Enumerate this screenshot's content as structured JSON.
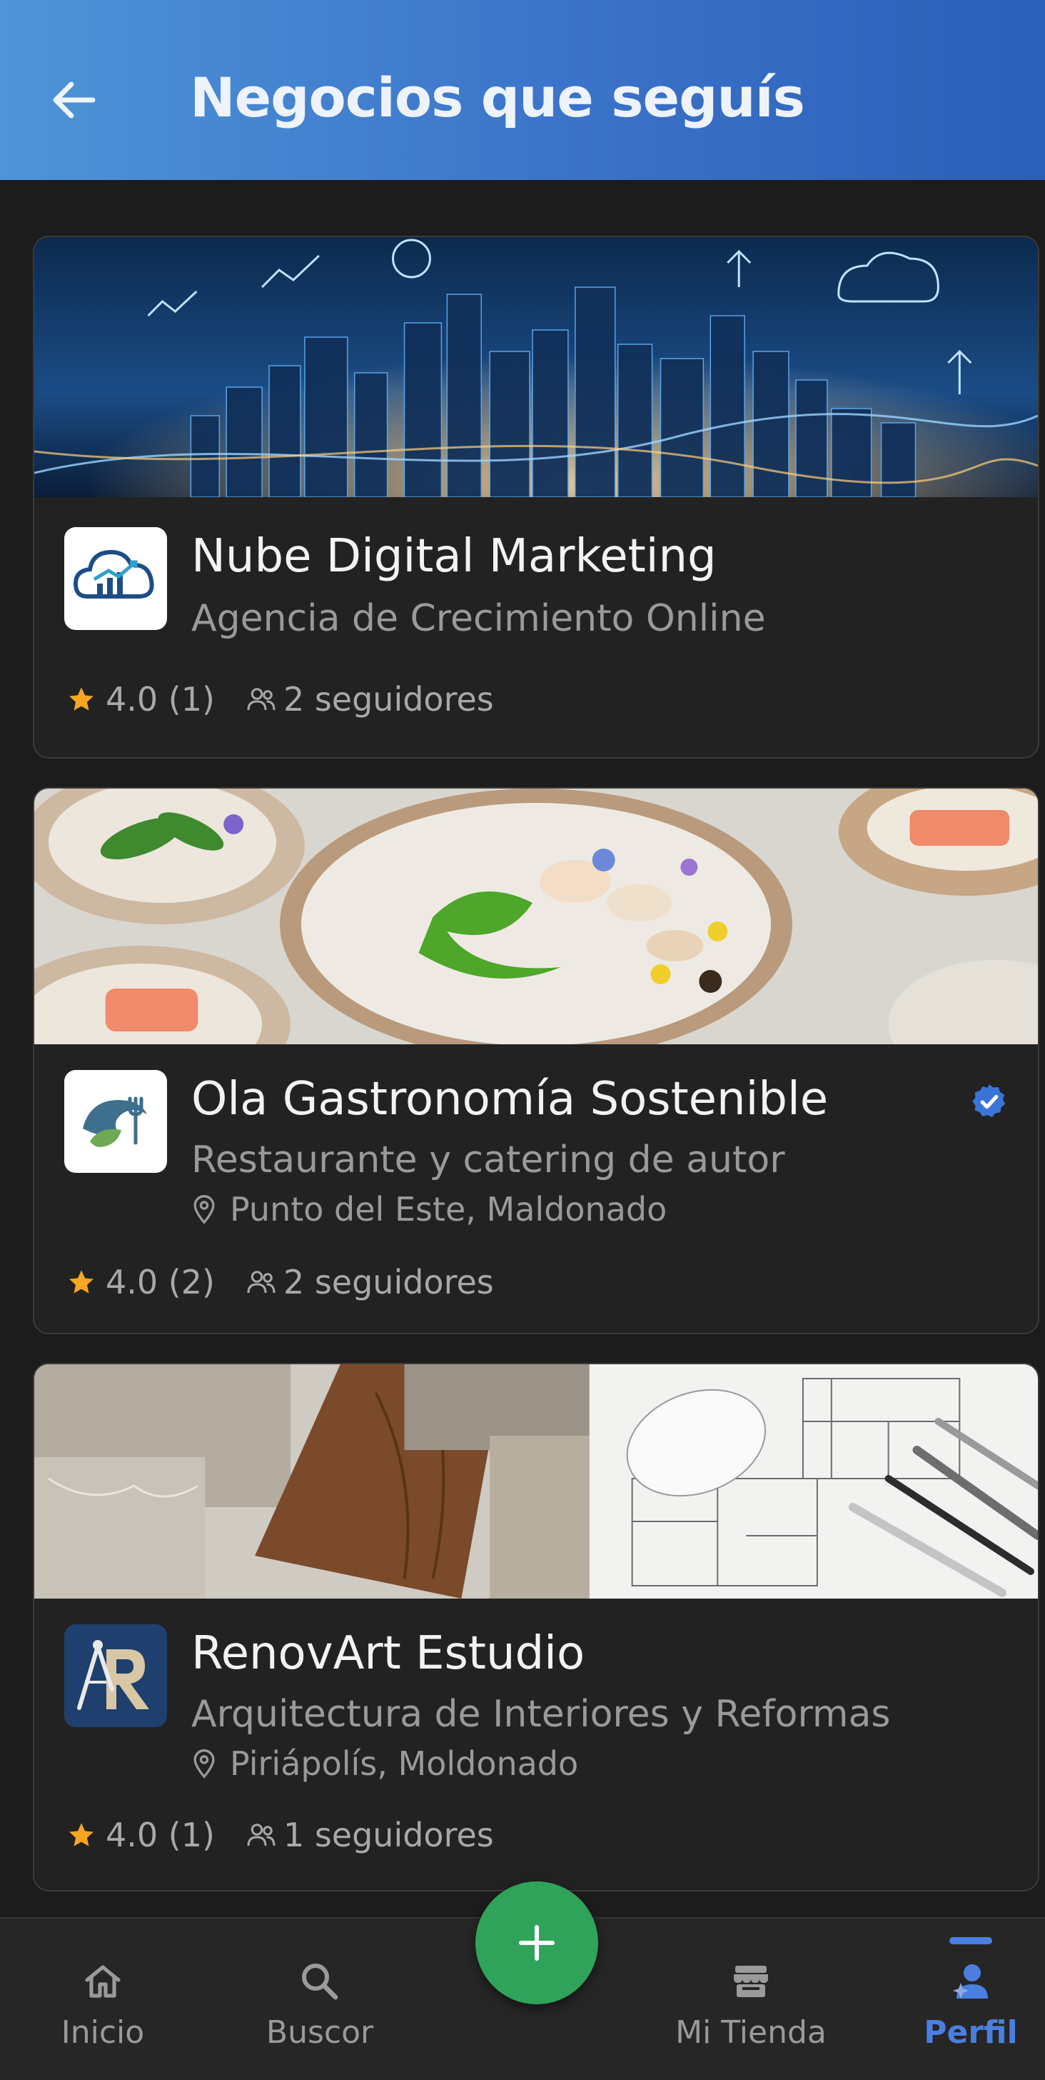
{
  "header": {
    "title": "Negocios que seguís"
  },
  "businesses": [
    {
      "name": "Nube Digital Marketing",
      "subtitle": "Agencia de Crecimiento Online",
      "location": "",
      "rating": "4.0 (1)",
      "followers": "2 seguidores",
      "verified": false,
      "logo_icon": "cloud-growth-logo-icon",
      "banner": "city-skyline-data-banner"
    },
    {
      "name": "Ola Gastronomía Sostenible",
      "subtitle": "Restaurante y catering de autor",
      "location": "Punto del Este, Maldonado",
      "rating": "4.0 (2)",
      "followers": "2 seguidores",
      "verified": true,
      "logo_icon": "wave-fork-leaf-logo-icon",
      "banner": "gourmet-plates-banner"
    },
    {
      "name": "RenovArt Estudio",
      "subtitle": "Arquitectura de Interiores y Reformas",
      "location": "Piriápolís, Moldonado",
      "rating": "4.0 (1)",
      "followers": "1 seguidores",
      "verified": false,
      "logo_icon": "compass-r-logo-icon",
      "banner": "materials-blueprints-banner"
    }
  ],
  "bottom_nav": {
    "items": [
      {
        "label": "Inicio",
        "icon": "home-icon",
        "active": false
      },
      {
        "label": "Buscor",
        "icon": "search-icon",
        "active": false
      },
      {
        "label": "Mi Tienda",
        "icon": "store-icon",
        "active": false
      },
      {
        "label": "Perfil",
        "icon": "profile-icon",
        "active": true
      }
    ],
    "fab_icon": "plus-icon"
  },
  "colors": {
    "header_gradient_start": "#4e94d8",
    "header_gradient_end": "#2b5fb8",
    "background": "#1c1c1c",
    "card": "#222222",
    "star": "#f5a623",
    "verified": "#3b74d6",
    "fab": "#2fa35a",
    "active_nav": "#4a7fe0"
  }
}
